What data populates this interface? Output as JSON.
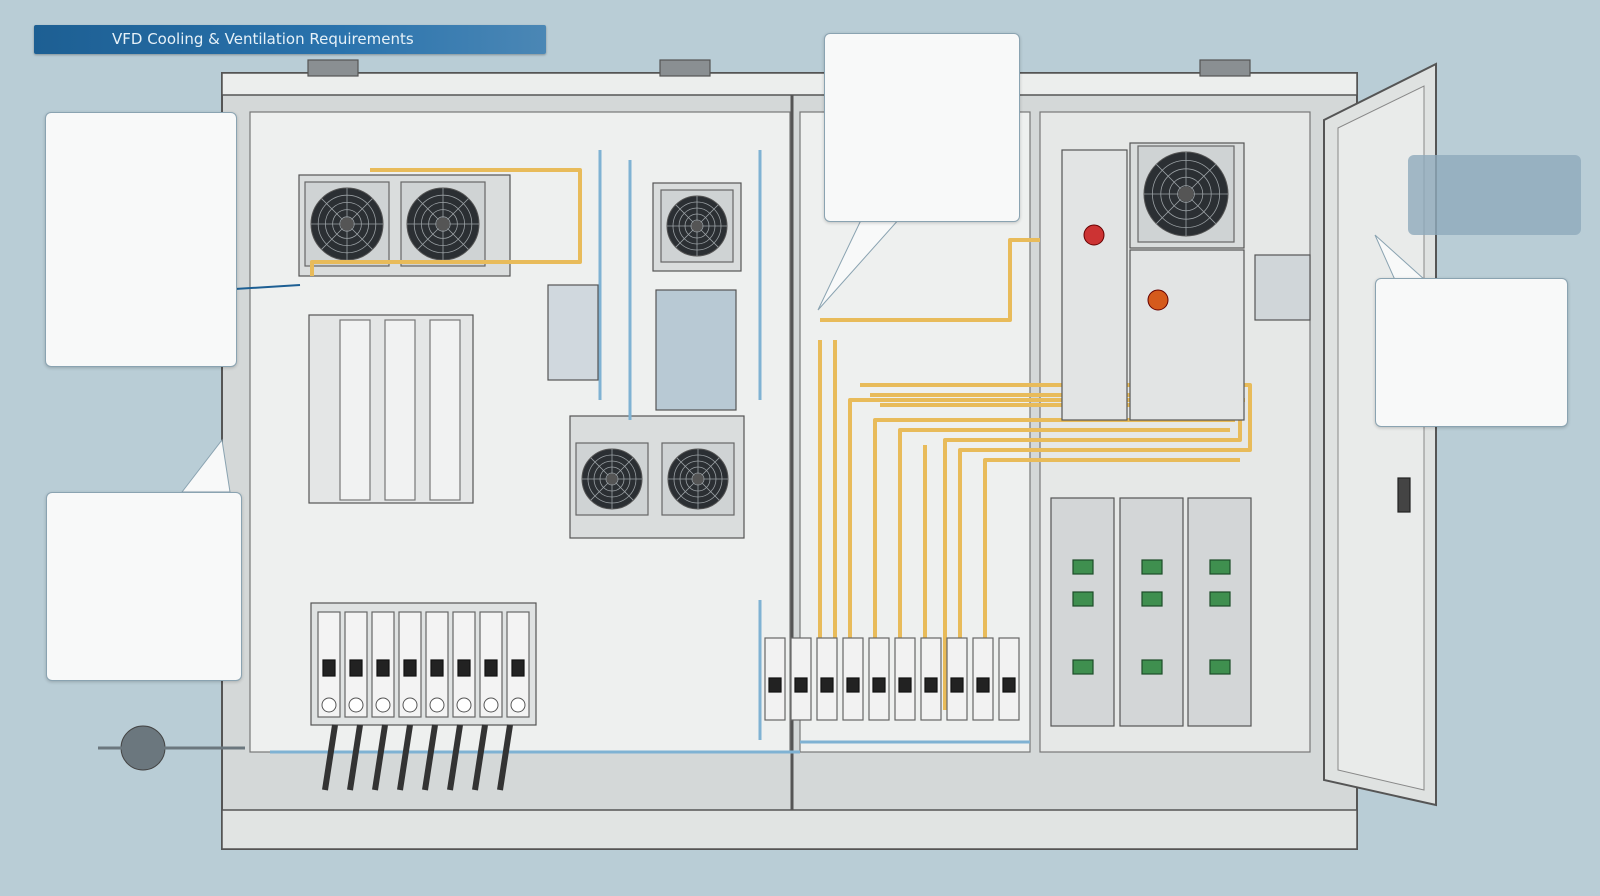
{
  "title": "VFD Cooling & Ventilation Requirements",
  "colors": {
    "background": "#b9cdd6",
    "title_bar": "#1d5f93",
    "cabinet": "#e9ebea",
    "cable": "#e8bb5a",
    "coolant_pipe": "#7fb2d3"
  },
  "callouts": [
    {
      "id": "left-upper",
      "text": ""
    },
    {
      "id": "left-lower",
      "text": ""
    },
    {
      "id": "top-center",
      "text": ""
    },
    {
      "id": "right",
      "text": ""
    }
  ],
  "icons": [
    "fan-icon",
    "breaker-icon",
    "vfd-drive-icon",
    "terminal-block-icon",
    "emergency-stop-icon",
    "cable-gland-icon"
  ]
}
